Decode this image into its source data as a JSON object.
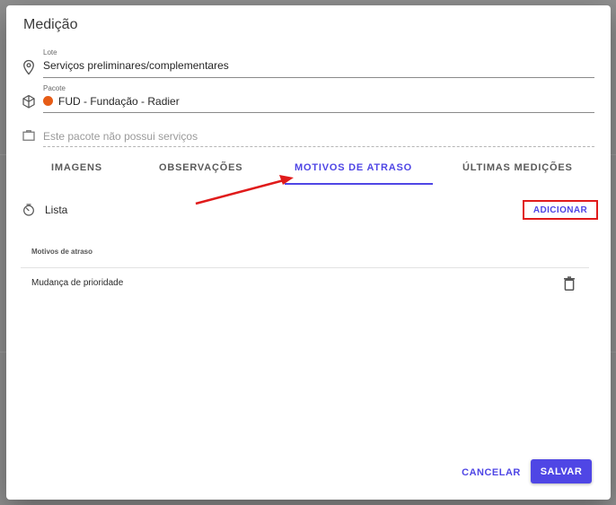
{
  "dialog": {
    "title": "Medição"
  },
  "fields": {
    "lote": {
      "label": "Lote",
      "value": "Serviços preliminares/complementares",
      "icon": "location-pin-icon"
    },
    "pacote": {
      "label": "Pacote",
      "value": "FUD - Fundação - Radier",
      "icon": "package-icon",
      "dot_color": "#e65c16"
    },
    "servicos": {
      "placeholder": "Este pacote não possui serviços",
      "icon": "briefcase-icon"
    }
  },
  "tabs": [
    {
      "label": "IMAGENS",
      "active": false
    },
    {
      "label": "OBSERVAÇÕES",
      "active": false
    },
    {
      "label": "MOTIVOS DE ATRASO",
      "active": true
    },
    {
      "label": "ÚLTIMAS MEDIÇÕES",
      "active": false
    }
  ],
  "list": {
    "title": "Lista",
    "icon": "timer-icon",
    "add_label": "ADICIONAR",
    "column_header": "Motivos de atraso",
    "rows": [
      {
        "text": "Mudança de prioridade",
        "action_icon": "trash-icon"
      }
    ]
  },
  "actions": {
    "cancel": "CANCELAR",
    "save": "SALVAR"
  },
  "colors": {
    "accent": "#4f46e5",
    "annotation": "#e01b1b",
    "dot": "#e65c16"
  }
}
